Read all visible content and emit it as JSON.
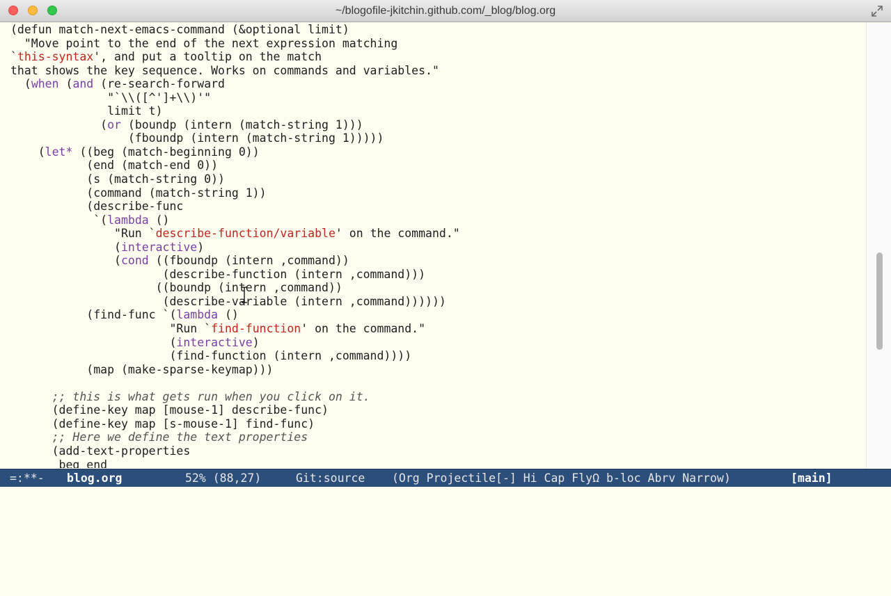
{
  "window": {
    "title": "~/blogofile-jkitchin.github.com/_blog/blog.org"
  },
  "editor": {
    "lines": [
      [
        {
          "t": "(defun match-next-emacs-command (&optional limit)"
        }
      ],
      [
        {
          "t": "  \"Move point to the end of the next expression matching"
        }
      ],
      [
        {
          "t": "`",
          "c": ""
        },
        {
          "t": "this-syntax",
          "c": "ref"
        },
        {
          "t": "', and put a tooltip on the match"
        }
      ],
      [
        {
          "t": "that shows the key sequence. Works on commands and variables.\""
        }
      ],
      [
        {
          "t": "  ("
        },
        {
          "t": "when",
          "c": "kw"
        },
        {
          "t": " ("
        },
        {
          "t": "and",
          "c": "kw"
        },
        {
          "t": " (re-search-forward"
        }
      ],
      [
        {
          "t": "              \"`\\\\([^']+\\\\)'\""
        }
      ],
      [
        {
          "t": "              limit t)"
        }
      ],
      [
        {
          "t": "             ("
        },
        {
          "t": "or",
          "c": "kw"
        },
        {
          "t": " (boundp (intern (match-string 1)))"
        }
      ],
      [
        {
          "t": "                 (fboundp (intern (match-string 1)))))"
        }
      ],
      [
        {
          "t": "    ("
        },
        {
          "t": "let*",
          "c": "kw"
        },
        {
          "t": " ((beg (match-beginning 0))"
        }
      ],
      [
        {
          "t": "           (end (match-end 0))"
        }
      ],
      [
        {
          "t": "           (s (match-string 0))"
        }
      ],
      [
        {
          "t": "           (command (match-string 1))"
        }
      ],
      [
        {
          "t": "           (describe-func"
        }
      ],
      [
        {
          "t": "            `("
        },
        {
          "t": "lambda",
          "c": "kw"
        },
        {
          "t": " ()"
        }
      ],
      [
        {
          "t": "               \"Run `"
        },
        {
          "t": "describe-function/variable",
          "c": "ref"
        },
        {
          "t": "' on the command.\""
        }
      ],
      [
        {
          "t": "               ("
        },
        {
          "t": "interactive",
          "c": "kw"
        },
        {
          "t": ")"
        }
      ],
      [
        {
          "t": "               ("
        },
        {
          "t": "cond",
          "c": "kw"
        },
        {
          "t": " ((fboundp (intern ,command))"
        }
      ],
      [
        {
          "t": "                      (describe-function (intern ,command)))"
        }
      ],
      [
        {
          "t": "                     ((boundp (intern ,command))"
        }
      ],
      [
        {
          "t": "                      (describe-variable (intern ,command))))))"
        }
      ],
      [
        {
          "t": "           (find-func `("
        },
        {
          "t": "lambda",
          "c": "kw"
        },
        {
          "t": " ()"
        }
      ],
      [
        {
          "t": "                       \"Run `"
        },
        {
          "t": "find-function",
          "c": "ref"
        },
        {
          "t": "' on the command.\""
        }
      ],
      [
        {
          "t": "                       ("
        },
        {
          "t": "interactive",
          "c": "kw"
        },
        {
          "t": ")"
        }
      ],
      [
        {
          "t": "                       (find-function (intern ,command))))"
        }
      ],
      [
        {
          "t": "           (map (make-sparse-keymap)))"
        }
      ],
      [
        {
          "t": ""
        }
      ],
      [
        {
          "t": "      ;; this is what gets run when you click on it.",
          "c": "cmt"
        }
      ],
      [
        {
          "t": "      (define-key map [mouse-1] describe-func)"
        }
      ],
      [
        {
          "t": "      (define-key map [s-mouse-1] find-func)"
        }
      ],
      [
        {
          "t": "      ;; Here we define the text properties",
          "c": "cmt"
        }
      ],
      [
        {
          "t": "      (add-text-properties"
        }
      ],
      [
        {
          "t": "       beg end"
        }
      ]
    ]
  },
  "modeline": {
    "status": "=:**-",
    "buffer": "blog.org",
    "position": "52% (88,27)",
    "vc": "Git:source",
    "modes": "(Org Projectile[-] Hi Cap FlyΩ b-loc Abrv Narrow)",
    "perspective": "[main]"
  },
  "colors": {
    "background": "#fefdf0",
    "modeline_bg": "#2c4e7a",
    "keyword": "#7a3fa5",
    "reference": "#c2261c"
  }
}
